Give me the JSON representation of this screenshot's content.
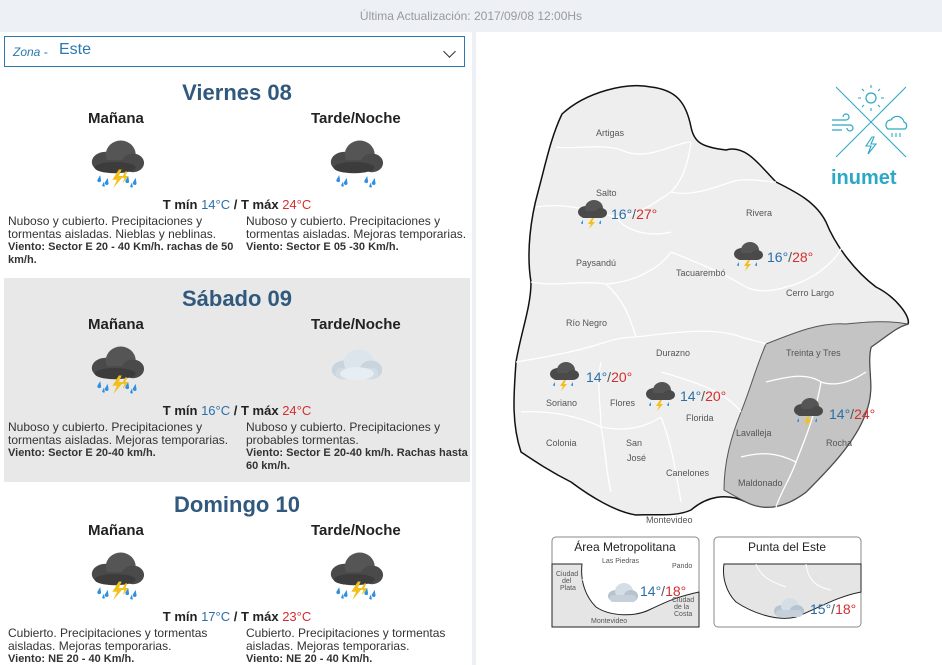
{
  "header": {
    "last_update": "Última Actualización: 2017/09/08 12:00Hs"
  },
  "zone": {
    "label": "Zona -",
    "value": "Este"
  },
  "days": [
    {
      "title": "Viernes 08",
      "morning_label": "Mañana",
      "night_label": "Tarde/Noche",
      "morning_icon": "storm-cloud-icon",
      "night_icon": "rain-cloud-icon",
      "tmin_label": "T mín",
      "tmin": "14°C",
      "sep": "/",
      "tmax_label": "T máx",
      "tmax": "24°C",
      "morning_desc": "Nuboso y cubierto. Precipitaciones y tormentas aisladas. Nieblas y neblinas.",
      "morning_wind": "Viento: Sector E 20 - 40 Km/h. rachas de 50 km/h.",
      "night_desc": "Nuboso y cubierto. Precipitaciones y tormentas aisladas. Mejoras temporarias.",
      "night_wind": "Viento: Sector E 05 -30 Km/h."
    },
    {
      "title": "Sábado 09",
      "morning_label": "Mañana",
      "night_label": "Tarde/Noche",
      "morning_icon": "storm-cloud-icon",
      "night_icon": "cloud-icon",
      "tmin_label": "T mín",
      "tmin": "16°C",
      "sep": "/",
      "tmax_label": "T máx",
      "tmax": "24°C",
      "morning_desc": "Nuboso y cubierto. Precipitaciones y tormentas aisladas. Mejoras temporarias.",
      "morning_wind": "Viento: Sector E 20-40 km/h.",
      "night_desc": "Nuboso y cubierto. Precipitaciones y probables tormentas.",
      "night_wind": "Viento: Sector E 20-40 km/h. Rachas hasta 60 km/h."
    },
    {
      "title": "Domingo 10",
      "morning_label": "Mañana",
      "night_label": "Tarde/Noche",
      "morning_icon": "storm-cloud-icon",
      "night_icon": "storm-cloud-icon",
      "tmin_label": "T mín",
      "tmin": "17°C",
      "sep": "/",
      "tmax_label": "T máx",
      "tmax": "23°C",
      "morning_desc": "Cubierto. Precipitaciones y tormentas aisladas. Mejoras temporarias.",
      "morning_wind": "Viento: NE 20 - 40 Km/h.",
      "night_desc": "Cubierto. Precipitaciones y tormentas aisladas. Mejoras temporarias.",
      "night_wind": "Viento: NE 20 - 40 Km/h."
    }
  ],
  "map": {
    "brand": "inumet",
    "departments": {
      "artigas": "Artigas",
      "salto": "Salto",
      "rivera": "Rivera",
      "paysandu": "Paysandú",
      "tacuarembo": "Tacuarembó",
      "cerro_largo": "Cerro Largo",
      "rio_negro": "Río Negro",
      "durazno": "Durazno",
      "treinta_y_tres": "Treinta y Tres",
      "soriano": "Soriano",
      "flores": "Flores",
      "florida": "Florida",
      "lavalleja": "Lavalleja",
      "rocha": "Rocha",
      "colonia": "Colonia",
      "san_jose_1": "San",
      "san_jose_2": "José",
      "canelones": "Canelones",
      "maldonado": "Maldonado",
      "montevideo": "Montevideo"
    },
    "readings": {
      "salto": {
        "min": "16°",
        "max": "27°"
      },
      "tacuarembo": {
        "min": "16°",
        "max": "28°"
      },
      "soriano": {
        "min": "14°",
        "max": "20°"
      },
      "florida": {
        "min": "14°",
        "max": "20°"
      },
      "este": {
        "min": "14°",
        "max": "24°"
      }
    },
    "sep": "/",
    "insets": {
      "metro": {
        "title": "Área Metropolitana",
        "labels": {
          "las_piedras": "Las Piedras",
          "pando": "Pando",
          "ciudad_plata_1": "Ciudad",
          "ciudad_plata_2": "del",
          "ciudad_plata_3": "Plata",
          "ciudad_costa_1": "Ciudad",
          "ciudad_costa_2": "de la",
          "ciudad_costa_3": "Costa",
          "montevideo": "Montevideo"
        },
        "min": "14°",
        "max": "18°"
      },
      "punta": {
        "title": "Punta del Este",
        "min": "15°",
        "max": "18°"
      }
    }
  }
}
